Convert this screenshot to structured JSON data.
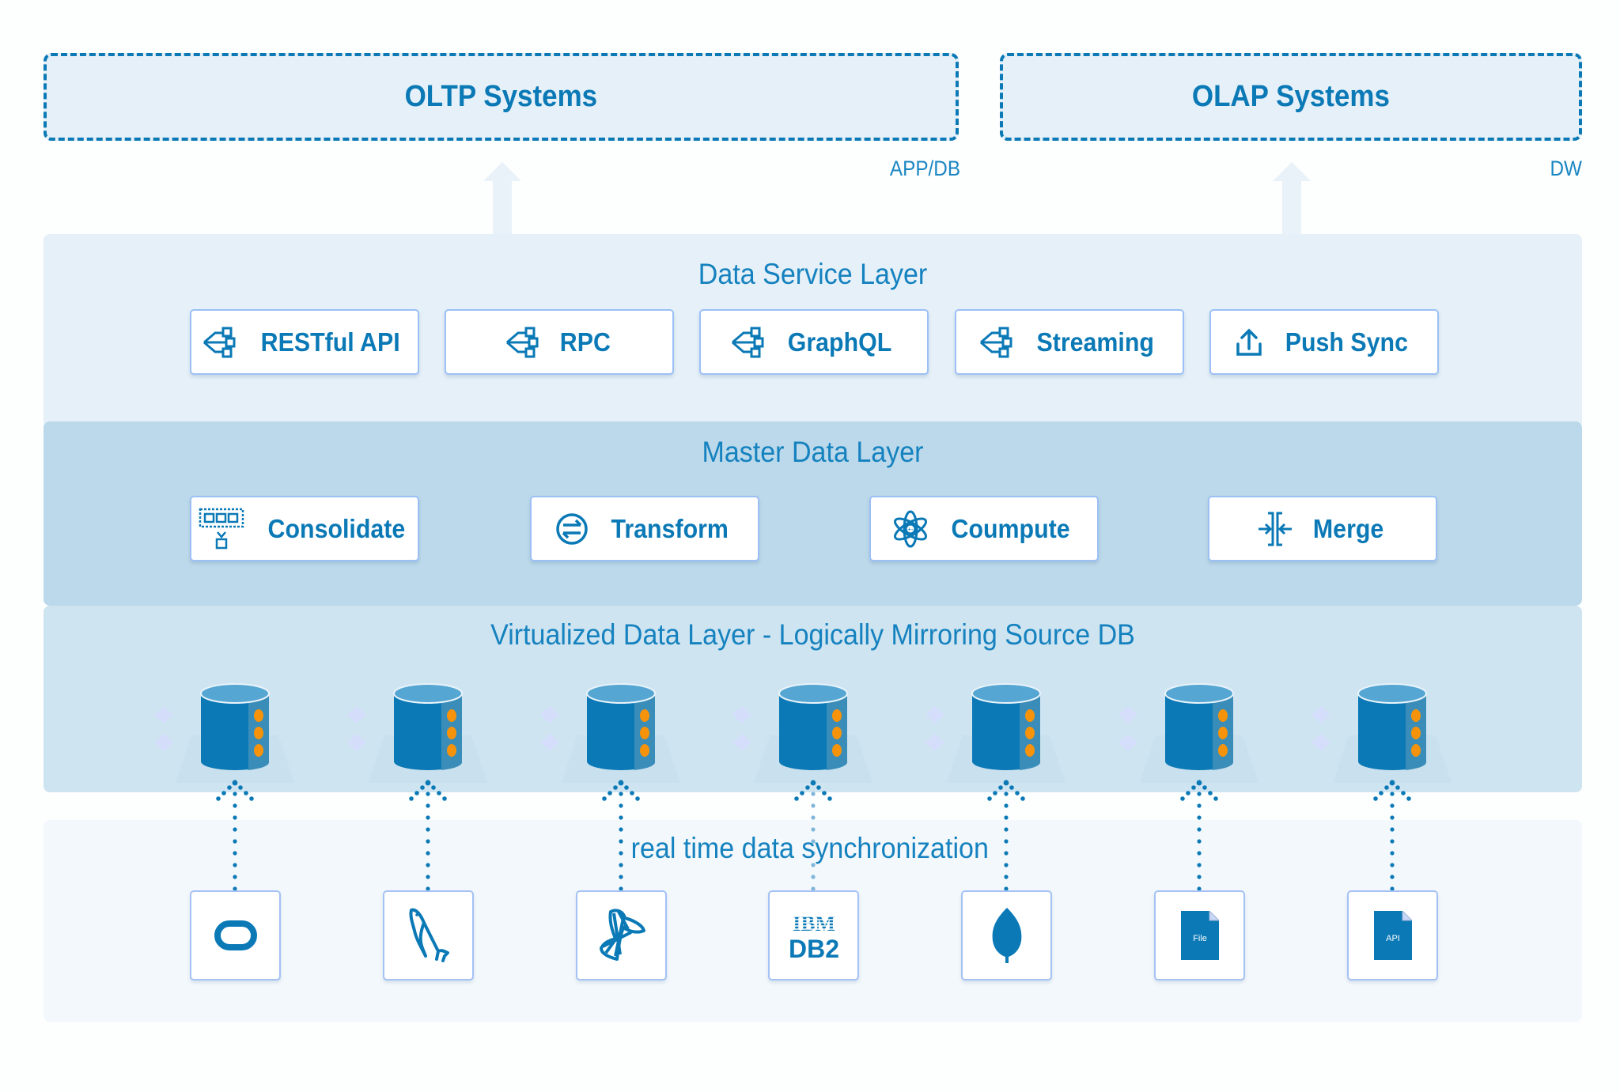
{
  "top_systems": [
    {
      "title": "OLTP Systems",
      "tag": "APP/DB"
    },
    {
      "title": "OLAP Systems",
      "tag": "DW"
    }
  ],
  "data_service_layer": {
    "title": "Data Service Layer",
    "cards": [
      {
        "label": "RESTful API",
        "icon": "network-tree-icon"
      },
      {
        "label": "RPC",
        "icon": "network-tree-icon"
      },
      {
        "label": "GraphQL",
        "icon": "network-tree-icon"
      },
      {
        "label": "Streaming",
        "icon": "network-tree-icon"
      },
      {
        "label": "Push Sync",
        "icon": "upload-icon"
      }
    ]
  },
  "master_data_layer": {
    "title": "Master Data Layer",
    "cards": [
      {
        "label": "Consolidate",
        "icon": "consolidate-icon"
      },
      {
        "label": "Transform",
        "icon": "transform-icon"
      },
      {
        "label": "Coumpute",
        "icon": "atom-icon"
      },
      {
        "label": "Merge",
        "icon": "merge-icon"
      }
    ]
  },
  "virtualized_data_layer": {
    "title": "Virtualized Data Layer - Logically Mirroring Source DB",
    "database_count": 7
  },
  "sources": {
    "caption": "real time data synchronization",
    "items": [
      {
        "name": "Oracle",
        "icon": "oracle-icon"
      },
      {
        "name": "MySQL",
        "icon": "mysql-dolphin-icon"
      },
      {
        "name": "SQL Server",
        "icon": "sqlserver-icon"
      },
      {
        "name": "IBM DB2",
        "icon": "ibm-db2-icon",
        "logo_top": "IBM",
        "logo_bottom": "DB2"
      },
      {
        "name": "MongoDB",
        "icon": "mongodb-leaf-icon"
      },
      {
        "name": "File",
        "icon": "file-icon",
        "doc_label": "File"
      },
      {
        "name": "API",
        "icon": "api-doc-icon",
        "doc_label": "API"
      }
    ]
  },
  "colors": {
    "primary": "#0a79b6",
    "service_layer_bg": "#e5f0f8",
    "master_layer_bg": "#bbd9ea",
    "virtual_layer_bg": "#cfe4f1",
    "source_layer_bg": "#f3f8fc",
    "db_body": "#0a79b6",
    "db_side": "#3a8db8",
    "db_top": "#55a6d2",
    "db_led": "#f7930a"
  }
}
